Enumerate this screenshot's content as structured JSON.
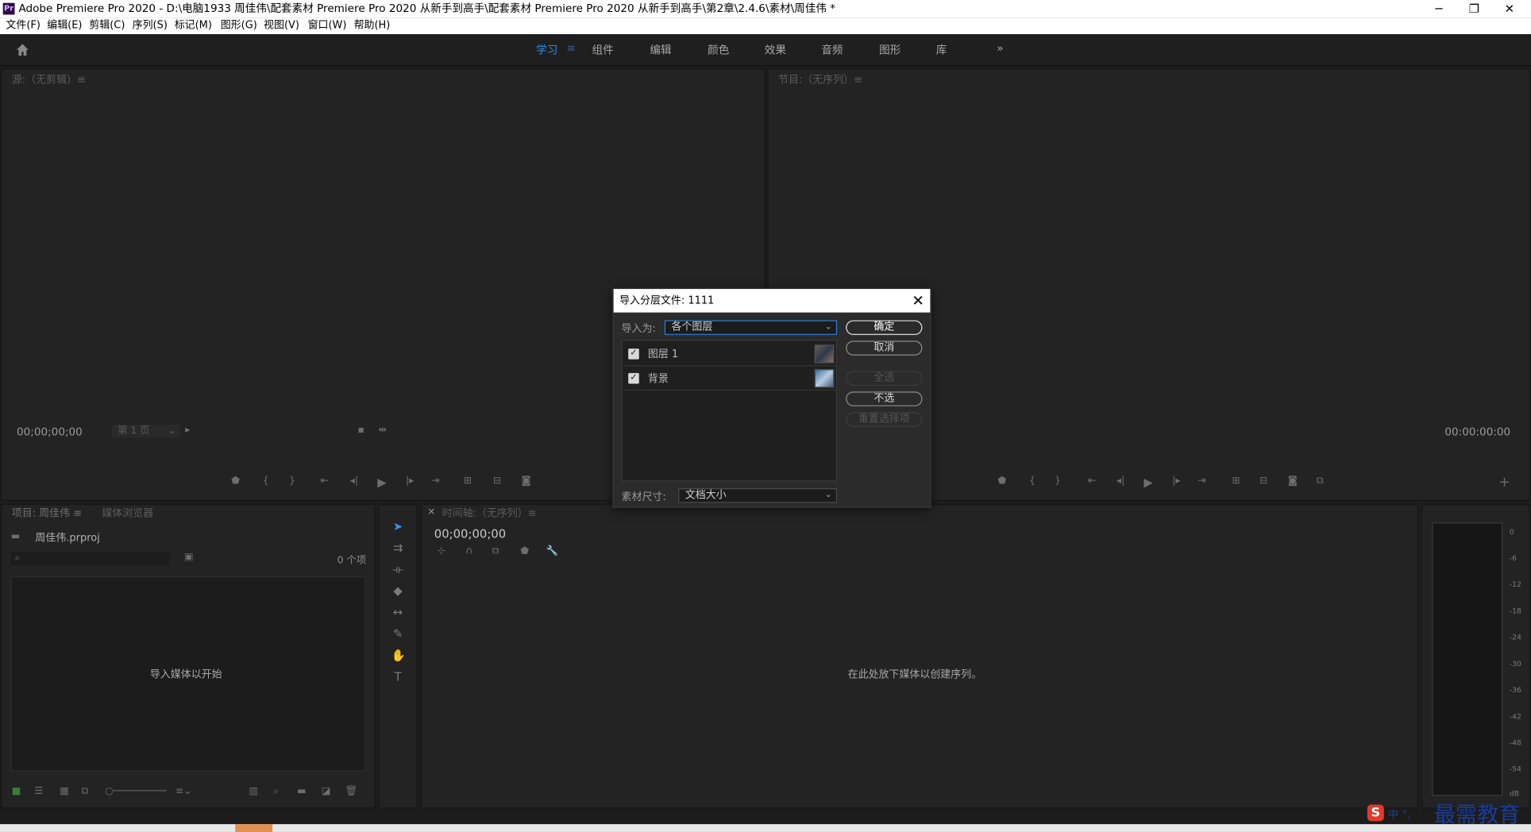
{
  "window": {
    "app_icon": "Pr",
    "title": "Adobe Premiere Pro 2020 - D:\\电脑1933 周佳伟\\配套素材 Premiere Pro 2020 从新手到高手\\配套素材 Premiere Pro 2020 从新手到高手\\第2章\\2.4.6\\素材\\周佳伟 *",
    "minimize_icon": "minimize-icon",
    "restore_icon": "restore-icon",
    "close_icon": "close-icon"
  },
  "menu": [
    "文件(F)",
    "编辑(E)",
    "剪辑(C)",
    "序列(S)",
    "标记(M)",
    "图形(G)",
    "视图(V)",
    "窗口(W)",
    "帮助(H)"
  ],
  "workspaces": {
    "home_icon": "home-icon",
    "tabs": [
      "学习",
      "组件",
      "编辑",
      "颜色",
      "效果",
      "音频",
      "图形",
      "库"
    ],
    "active": "学习",
    "more": "»"
  },
  "source_monitor": {
    "title": "源:（无剪辑）≡",
    "timecode": "00;00;00;00",
    "page_select": "第 1 页"
  },
  "program_monitor": {
    "title": "节目:（无序列）≡",
    "timecode": "00:00:00:00"
  },
  "project_panel": {
    "tab_project": "项目: 周佳伟 ≡",
    "tab_media_browser": "媒体浏览器",
    "file_name": "周佳伟.prproj",
    "item_count": "0 个项",
    "empty_message": "导入媒体以开始"
  },
  "timeline_panel": {
    "tab": "时间轴:（无序列）≡",
    "timecode": "00;00;00;00",
    "empty_message": "在此处放下媒体以创建序列。"
  },
  "audio_meter": {
    "ticks": [
      "0",
      "-6",
      "-12",
      "-18",
      "-24",
      "-30",
      "-36",
      "-42",
      "-48",
      "-54",
      "dB"
    ]
  },
  "dialog": {
    "title": "导入分层文件: 1111",
    "import_as_label": "导入为:",
    "import_as_value": "各个图层",
    "layers": [
      {
        "name": "图层 1",
        "checked": true
      },
      {
        "name": "背景",
        "checked": true
      }
    ],
    "footage_size_label": "素材尺寸:",
    "footage_size_value": "文档大小",
    "buttons": {
      "ok": "确定",
      "cancel": "取消",
      "select_all": "全选",
      "select_none": "不选",
      "reset": "重置选择项"
    }
  },
  "watermark": {
    "ime": "中 °,",
    "brand": "最需教育"
  },
  "colors": {
    "accent": "#2d8ceb",
    "panel_bg": "#232323",
    "dialog_bg": "#2b2b2b"
  }
}
